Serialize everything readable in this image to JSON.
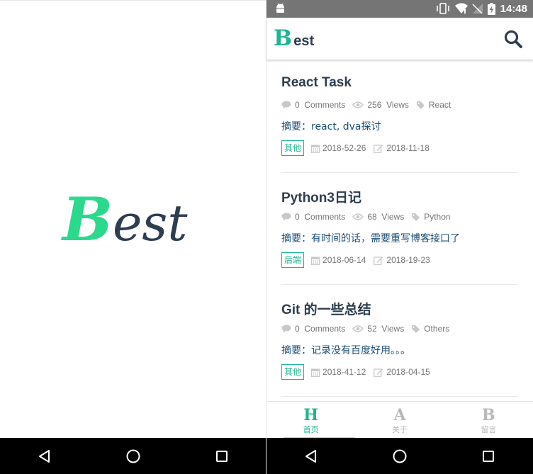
{
  "splash": {
    "logo_initial": "B",
    "logo_rest": "est"
  },
  "status_bar": {
    "time": "14:48",
    "icons": [
      "android-icon",
      "vibrate-icon",
      "wifi-icon",
      "no-sim-icon",
      "battery-charging-icon"
    ]
  },
  "app_bar": {
    "logo_initial": "B",
    "logo_rest": "est",
    "search_icon": "search-icon"
  },
  "articles": [
    {
      "title": "React Task",
      "comments": "0",
      "comments_label": "Comments",
      "views": "256",
      "views_label": "Views",
      "tag": "React",
      "summary": "摘要：react, dva探讨",
      "category": "其他",
      "created": "2018-52-26",
      "updated": "2018-11-18"
    },
    {
      "title": "Python3日记",
      "comments": "0",
      "comments_label": "Comments",
      "views": "68",
      "views_label": "Views",
      "tag": "Python",
      "summary": "摘要：有时间的话，需要重写博客接口了",
      "category": "后端",
      "created": "2018-06-14",
      "updated": "2018-19-23"
    },
    {
      "title": "Git 的一些总结",
      "comments": "0",
      "comments_label": "Comments",
      "views": "52",
      "views_label": "Views",
      "tag": "Others",
      "summary": "摘要：记录没有百度好用。。。",
      "category": "其他",
      "created": "2018-41-12",
      "updated": "2018-04-15"
    }
  ],
  "tabs": [
    {
      "icon": "H",
      "label": "首页",
      "active": true
    },
    {
      "icon": "A",
      "label": "关于",
      "active": false
    },
    {
      "icon": "B",
      "label": "留言",
      "active": false
    }
  ],
  "nav_bar": {
    "icons": [
      "back-icon",
      "home-icon",
      "recents-icon"
    ]
  },
  "colors": {
    "accent": "#1fb594",
    "splash_accent": "#2bd98c",
    "text_dark": "#2c3e50",
    "summary_text": "#1c4e7a",
    "status_bar": "#757575"
  }
}
